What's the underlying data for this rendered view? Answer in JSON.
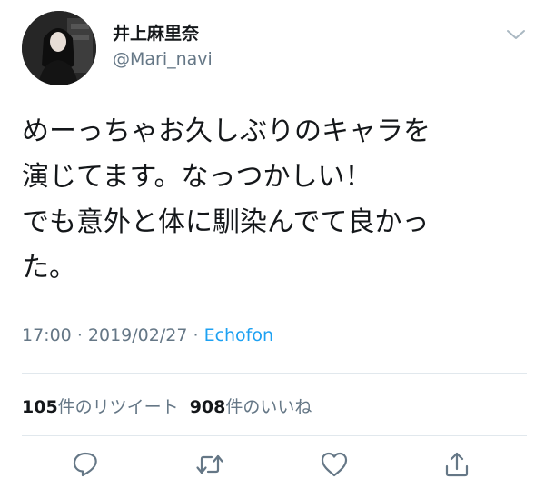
{
  "user": {
    "display_name": "井上麻里奈",
    "handle": "@Mari_navi"
  },
  "tweet": {
    "lines": [
      "めーっちゃお久しぶりのキャラを",
      "演じてます。なっつかしい！",
      "でも意外と体に馴染んでて良かっ",
      "た。"
    ],
    "time": "17:00",
    "date": "2019/02/27",
    "separator": "·",
    "source": "Echofon"
  },
  "stats": {
    "retweets_count": "105",
    "retweets_label": "件のリツイート",
    "likes_count": "908",
    "likes_label": "件のいいね"
  },
  "actions": {
    "reply_icon": "reply-icon",
    "retweet_icon": "retweet-icon",
    "like_icon": "heart-icon",
    "share_icon": "share-icon"
  },
  "colors": {
    "text": "#14171a",
    "secondary": "#657786",
    "link": "#1da1f2",
    "divider": "#e1e8ed"
  }
}
